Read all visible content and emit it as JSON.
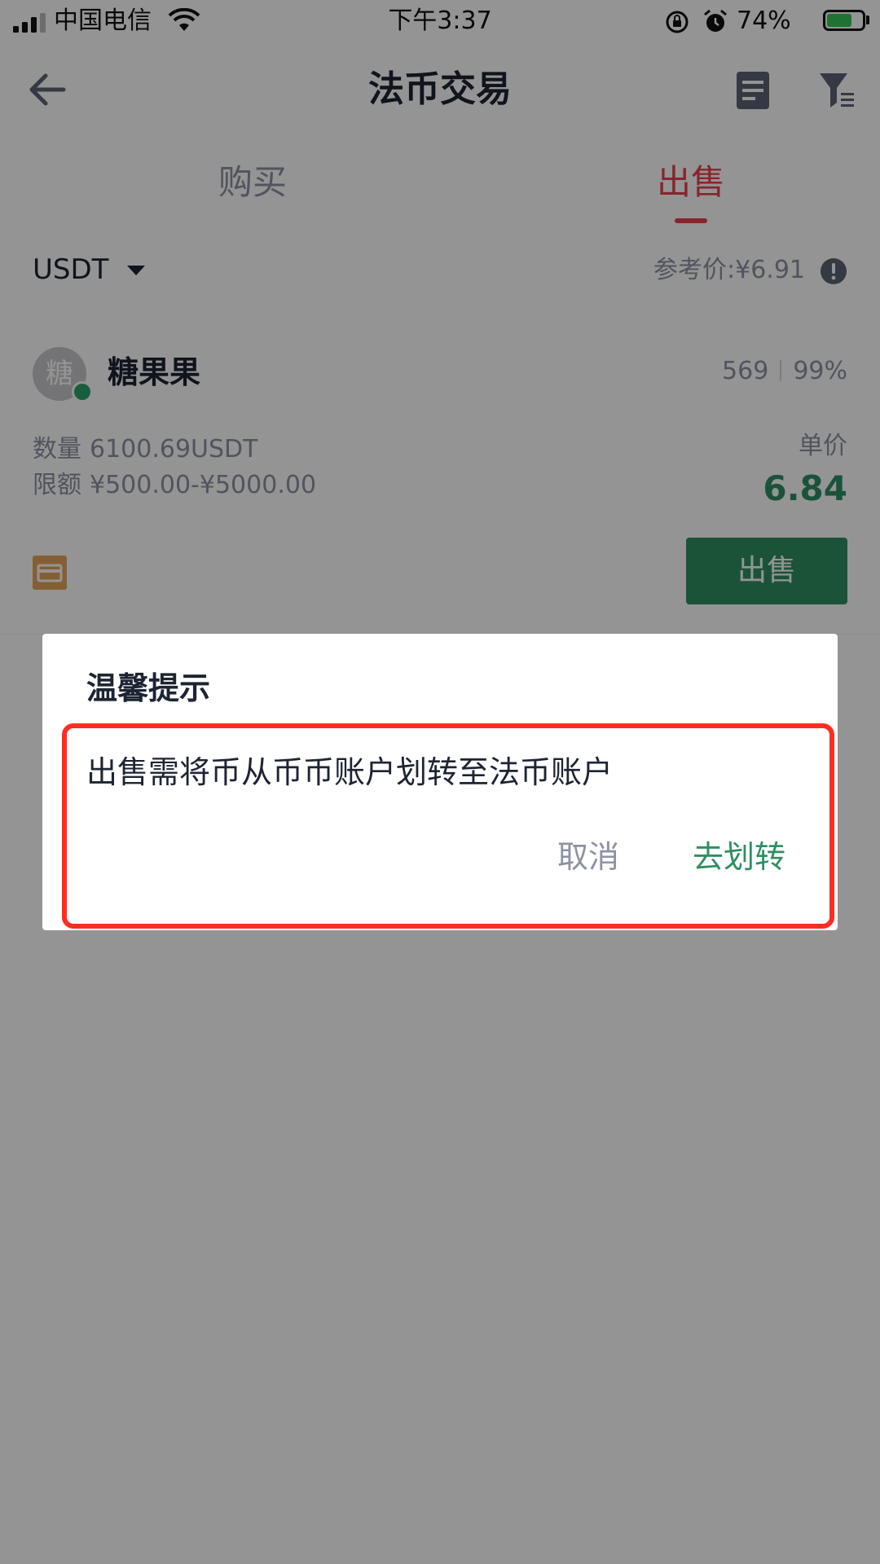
{
  "status_bar": {
    "carrier": "中国电信",
    "time": "下午3:37",
    "battery_percent": "74%",
    "battery_level": 0.74,
    "icons": [
      "signal-icon",
      "wifi-icon",
      "orientation-lock-icon",
      "alarm-icon",
      "battery-icon",
      "charging-bolt-icon"
    ]
  },
  "nav": {
    "title": "法币交易",
    "icons": [
      "back-arrow-icon",
      "order-list-icon",
      "filter-icon"
    ]
  },
  "tabs": [
    {
      "label": "购买",
      "active": false
    },
    {
      "label": "出售",
      "active": true
    }
  ],
  "filter": {
    "coin": "USDT",
    "ref_price": "参考价:¥6.91"
  },
  "offer": {
    "avatar_char": "糖",
    "merchant": "糖果果",
    "orders": "569",
    "completion": "99%",
    "qty_label": "数量",
    "qty_value": "6100.69USDT",
    "limit_label": "限额",
    "limit_value": "¥500.00-¥5000.00",
    "unit_price_label": "单价",
    "unit_price": "6.84",
    "action_label": "出售",
    "payment_icon": "bank-card-icon"
  },
  "dialog": {
    "title": "温馨提示",
    "message": "出售需将币从币币账户划转至法币账户",
    "cancel_label": "取消",
    "confirm_label": "去划转"
  },
  "colors": {
    "sell_red": "#e8404b",
    "buy_green": "#2e8f62",
    "highlight_red": "#ff2d20"
  }
}
